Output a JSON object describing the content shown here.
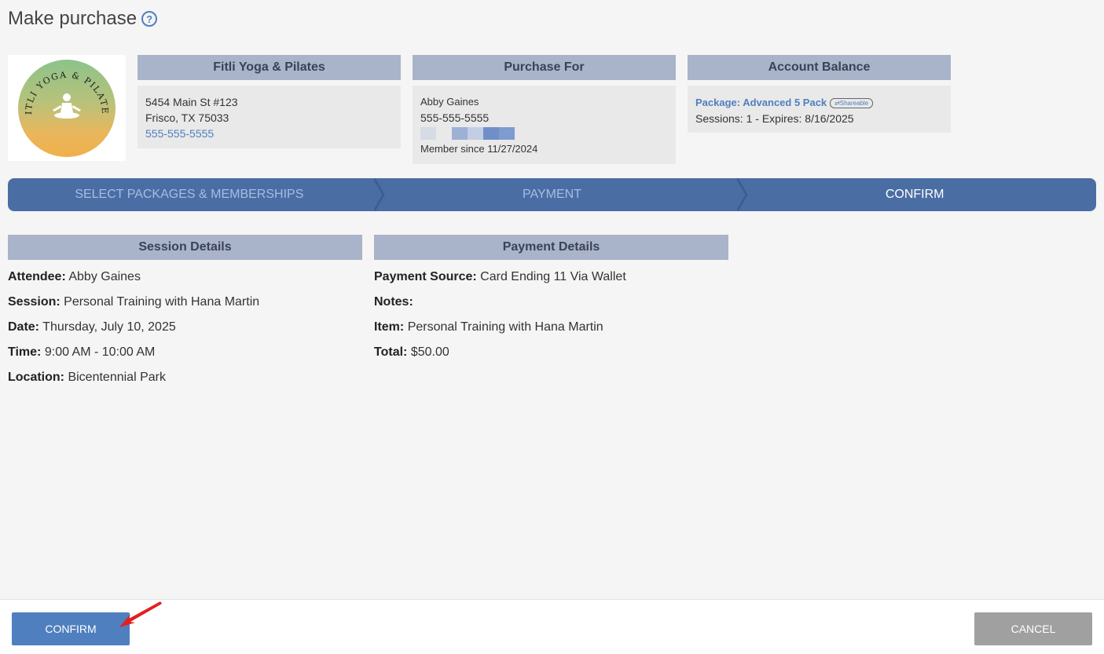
{
  "page": {
    "title": "Make purchase"
  },
  "colors": {
    "accent": "#4f7fbf",
    "stepbar": "#4a6ea4",
    "header": "#a9b3c9",
    "cancel": "#a0a0a0",
    "arrow": "#e02020"
  },
  "logo": {
    "text": "FITLI YOGA & PILATES"
  },
  "business": {
    "header": "Fitli Yoga & Pilates",
    "address1": "5454 Main St #123",
    "address2": "Frisco, TX 75033",
    "phone": "555-555-5555"
  },
  "purchase_for": {
    "header": "Purchase For",
    "name": "Abby Gaines",
    "phone": "555-555-5555",
    "member_since": "Member since 11/27/2024"
  },
  "account_balance": {
    "header": "Account Balance",
    "package": "Package: Advanced 5 Pack",
    "badge": "Shareable",
    "sessions": "Sessions: 1 -",
    "expires": "Expires: 8/16/2025"
  },
  "steps": [
    {
      "label": "SELECT PACKAGES & MEMBERSHIPS"
    },
    {
      "label": "PAYMENT"
    },
    {
      "label": "CONFIRM"
    }
  ],
  "session_details": {
    "header": "Session Details",
    "rows": [
      {
        "label": "Attendee:",
        "value": "Abby Gaines"
      },
      {
        "label": "Session:",
        "value": "Personal Training with Hana Martin"
      },
      {
        "label": "Date:",
        "value": "Thursday, July 10, 2025"
      },
      {
        "label": "Time:",
        "value": "9:00 AM - 10:00 AM"
      },
      {
        "label": "Location:",
        "value": "Bicentennial Park"
      }
    ]
  },
  "payment_details": {
    "header": "Payment Details",
    "rows": [
      {
        "label": "Payment Source:",
        "value": "Card Ending 11 Via Wallet"
      },
      {
        "label": "Notes:",
        "value": ""
      },
      {
        "label": "Item:",
        "value": "Personal Training with Hana Martin"
      },
      {
        "label": "Total:",
        "value": "$50.00"
      }
    ]
  },
  "footer": {
    "confirm_label": "CONFIRM",
    "cancel_label": "CANCEL"
  }
}
